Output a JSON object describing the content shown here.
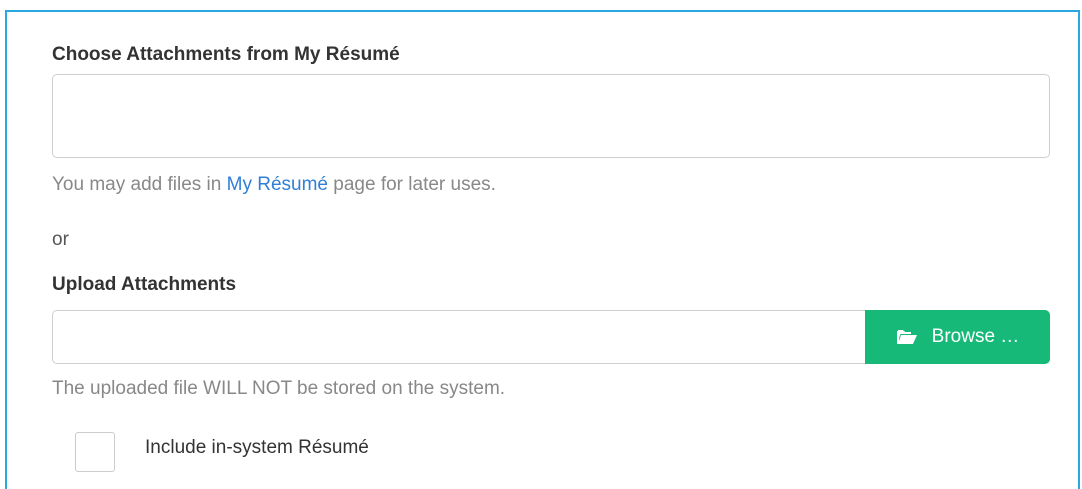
{
  "resume_section": {
    "label": "Choose Attachments from My Résumé",
    "help_prefix": "You may add files in ",
    "help_link": "My Résumé",
    "help_suffix": " page for later uses."
  },
  "separator": {
    "text": "or"
  },
  "upload_section": {
    "label": "Upload Attachments",
    "input_value": "",
    "browse_label": "Browse …",
    "browse_icon": "folder-open-icon",
    "help": "The uploaded file WILL NOT be stored on the system."
  },
  "include_resume": {
    "label": "Include in-system Résumé",
    "checked": false
  },
  "colors": {
    "panel_border": "#29a8e0",
    "browse_button": "#17b978",
    "link": "#2f7fd6"
  }
}
